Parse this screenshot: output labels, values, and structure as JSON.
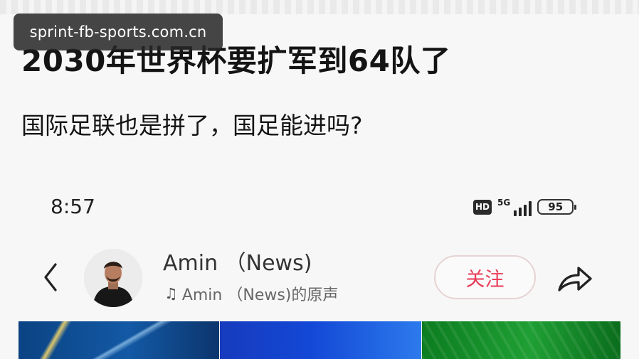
{
  "watermark": "sprint-fb-sports.com.cn",
  "post": {
    "headline": "2030年世界杯要扩军到64队了",
    "subline": "国际足联也是拼了，国足能进吗?"
  },
  "phone": {
    "time": "8:57",
    "hd": "HD",
    "network": "5G",
    "battery": "95"
  },
  "profile": {
    "name": "Amin （News)",
    "sound": "Amin （News)的原声",
    "follow_label": "关注"
  },
  "icons": {
    "back": "back-chevron-icon",
    "music": "music-note-icon",
    "share": "share-arrow-icon",
    "battery": "battery-icon",
    "signal": "signal-icon"
  },
  "colors": {
    "accent": "#ea3a55",
    "page_bg": "#f7f7f7"
  }
}
